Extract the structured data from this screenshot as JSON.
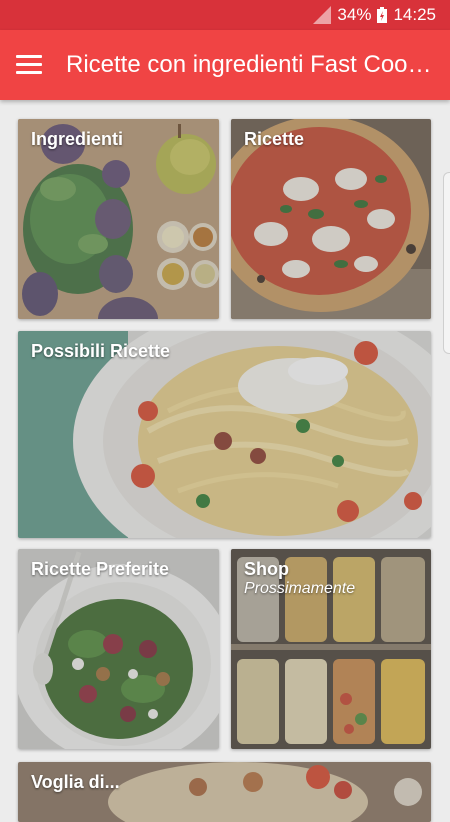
{
  "status_bar": {
    "battery": "34%",
    "time": "14:25"
  },
  "app_bar": {
    "title": "Ricette con ingredienti Fast Cooking",
    "menu_icon": "hamburger-menu-icon"
  },
  "cards": {
    "ingredienti": {
      "label": "Ingredienti",
      "image": "vegetables-and-spices-photo"
    },
    "ricette": {
      "label": "Ricette",
      "image": "pizza-photo"
    },
    "possibili": {
      "label": "Possibili Ricette",
      "image": "pasta-photo"
    },
    "preferite": {
      "label": "Ricette Preferite",
      "image": "salad-photo"
    },
    "shop": {
      "label": "Shop",
      "sublabel": "Prossimamente",
      "image": "pasta-jars-photo"
    },
    "voglia": {
      "label": "Voglia di...",
      "image": "food-photo"
    }
  },
  "colors": {
    "status_bar": "#d8323a",
    "app_bar": "#f04444",
    "background": "#ececec"
  }
}
